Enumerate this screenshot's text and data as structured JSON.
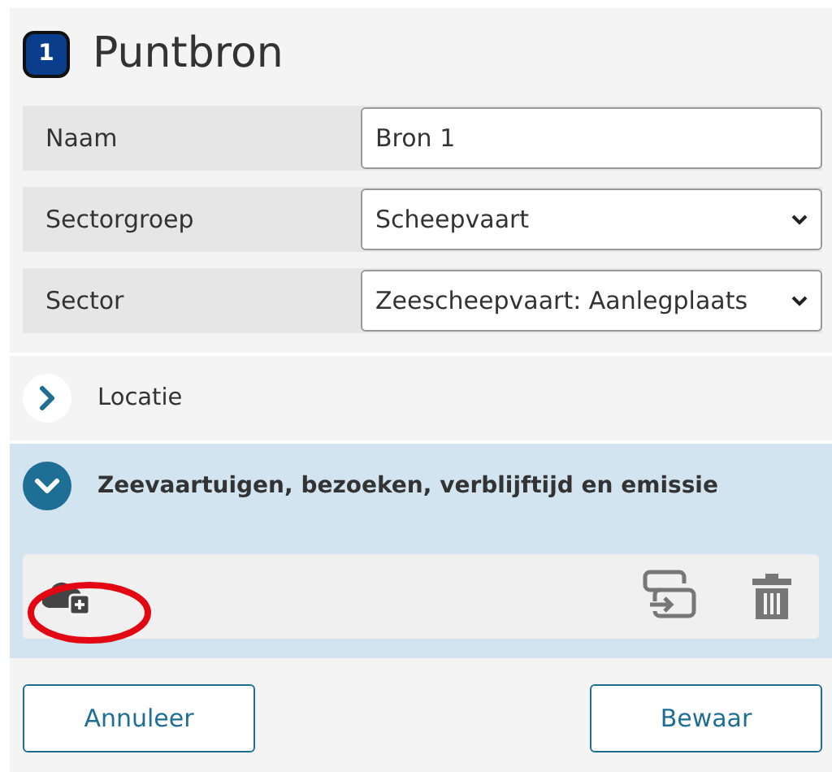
{
  "header": {
    "number": "1",
    "title": "Puntbron"
  },
  "fields": [
    {
      "label": "Naam",
      "kind": "text",
      "value": "Bron 1"
    },
    {
      "label": "Sectorgroep",
      "kind": "select",
      "value": "Scheepvaart"
    },
    {
      "label": "Sector",
      "kind": "select",
      "value": "Zeescheepvaart: Aanlegplaats"
    }
  ],
  "sections": [
    {
      "title": "Locatie",
      "expanded": false
    },
    {
      "title": "Zeevaartuigen, bezoeken, verblijftijd en emissie",
      "expanded": true
    }
  ],
  "buttons": [
    "Annuleer",
    "Bewaar"
  ]
}
